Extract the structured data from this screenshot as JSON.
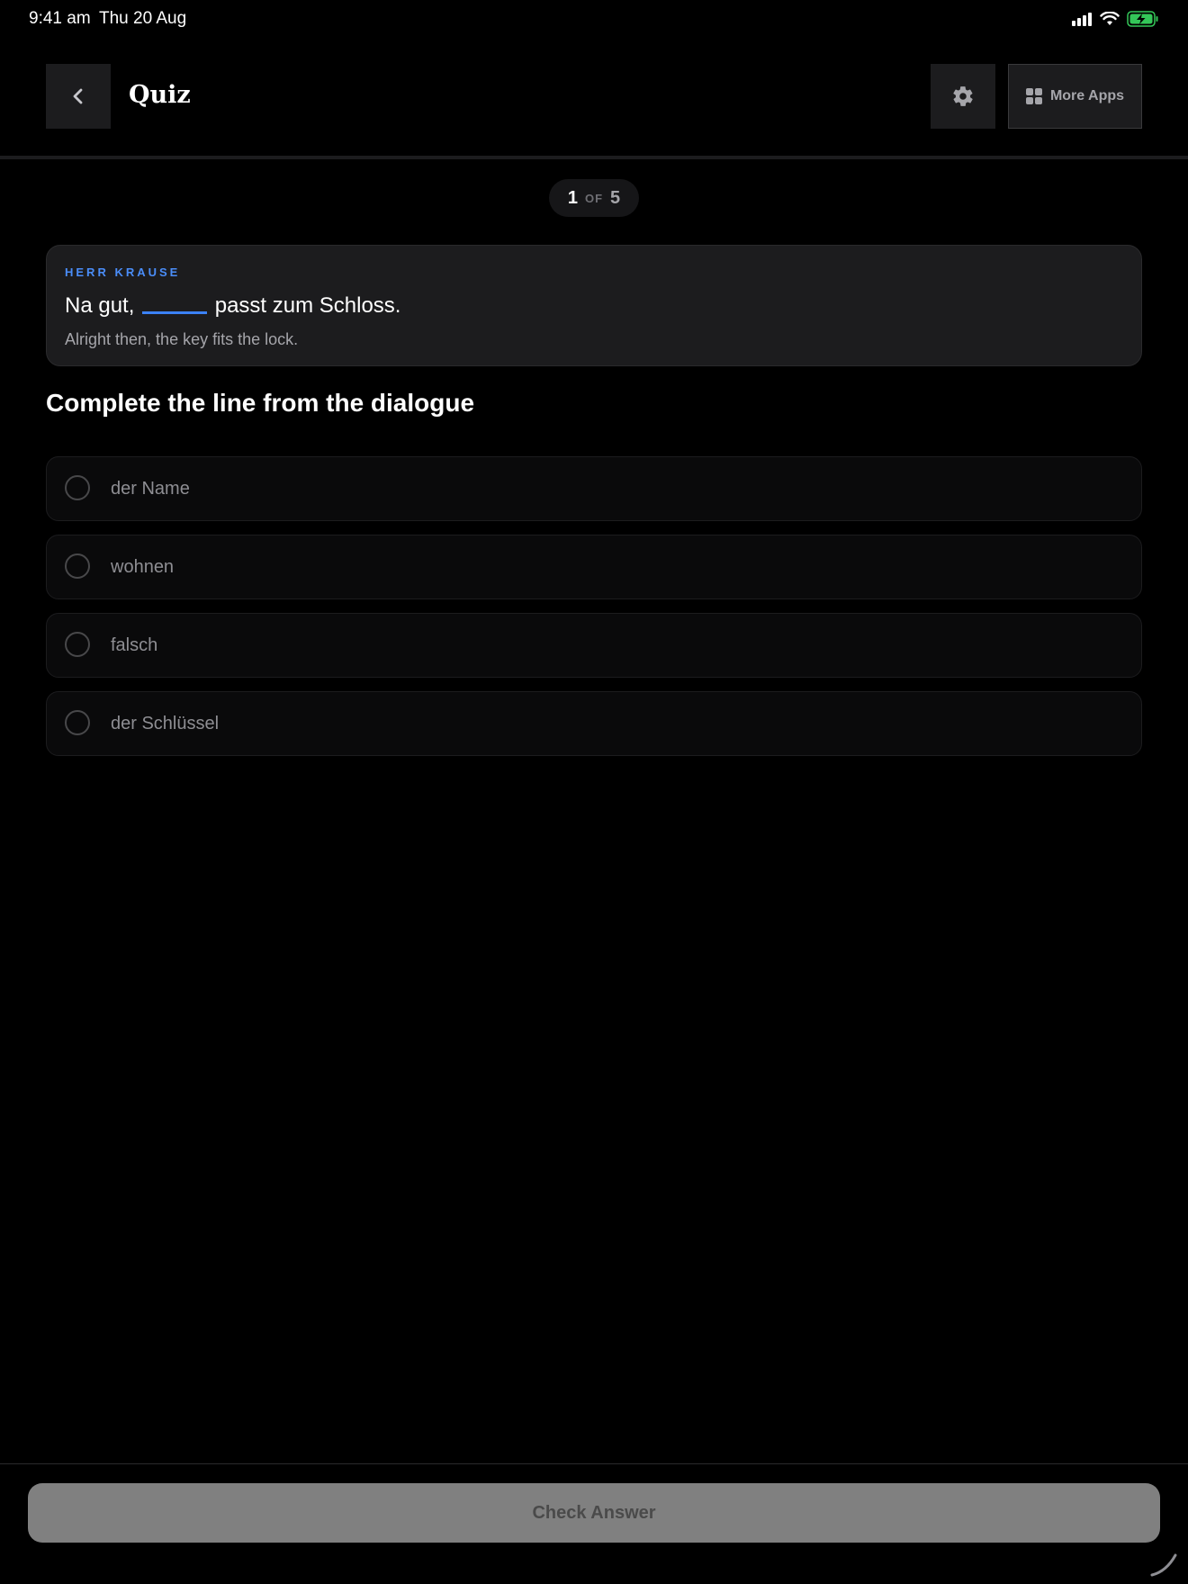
{
  "status_bar": {
    "time": "9:41 am",
    "date": "Thu 20 Aug",
    "icons": [
      "signal-icon",
      "wifi-icon",
      "battery-charging-icon"
    ],
    "battery_color": "#34c759"
  },
  "header": {
    "back_icon": "chevron-left-icon",
    "title": "Quiz",
    "settings_icon": "gear-icon",
    "more_apps_icon": "grid-icon",
    "more_apps_label": "More Apps"
  },
  "progress": {
    "current": "1",
    "of": "OF",
    "total": "5"
  },
  "dialogue": {
    "speaker": "HERR KRAUSE",
    "sentence_before": "Na gut,",
    "sentence_after": "passt zum Schloss.",
    "translation": "Alright then, the key fits the lock."
  },
  "question": "Complete the line from the dialogue",
  "options": [
    {
      "label": "der Name",
      "selected": false
    },
    {
      "label": "wohnen",
      "selected": false
    },
    {
      "label": "falsch",
      "selected": false
    },
    {
      "label": "der Schlüssel",
      "selected": false
    }
  ],
  "footer": {
    "check_label": "Check Answer"
  },
  "colors": {
    "background": "#000000",
    "accent": "#4a8df8",
    "card": "#1c1c1e"
  }
}
